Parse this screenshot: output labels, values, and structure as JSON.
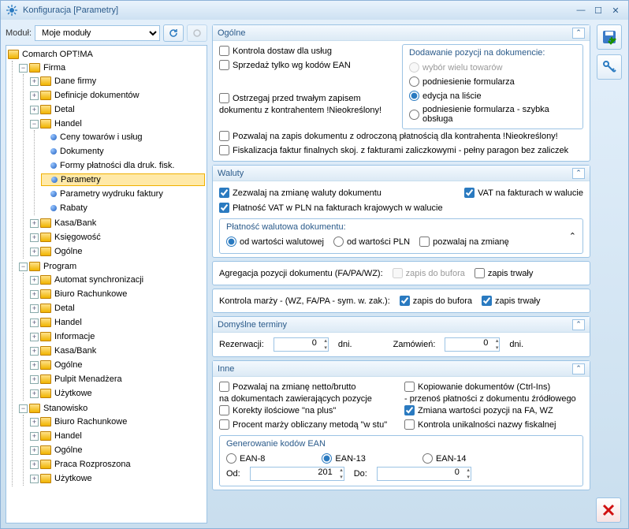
{
  "window": {
    "title": "Konfiguracja [Parametry]"
  },
  "module": {
    "label": "Moduł:",
    "value": "Moje moduły"
  },
  "tree": {
    "root": "Comarch OPT!MA",
    "firma": "Firma",
    "dane_firmy": "Dane firmy",
    "def_dok": "Definicje dokumentów",
    "detal": "Detal",
    "handel": "Handel",
    "ceny_tow": "Ceny towarów i usług",
    "dokumenty": "Dokumenty",
    "formy_plat": "Formy płatności dla druk. fisk.",
    "parametry": "Parametry",
    "param_wydr": "Parametry wydruku faktury",
    "rabaty": "Rabaty",
    "kasa_bank": "Kasa/Bank",
    "ksiegowosc": "Księgowość",
    "ogolne": "Ogólne",
    "program": "Program",
    "auto_sync": "Automat synchronizacji",
    "biuro_rach": "Biuro Rachunkowe",
    "informacje": "Informacje",
    "pulpit": "Pulpit Menadżera",
    "uzytkowe": "Użytkowe",
    "stanowisko": "Stanowisko",
    "praca_rozp": "Praca Rozproszona"
  },
  "ogolne": {
    "title": "Ogólne",
    "kontrola_dostaw": "Kontrola dostaw dla usług",
    "sprzedaz_ean": "Sprzedaż tylko wg kodów EAN",
    "ostrzegaj": "Ostrzegaj przed trwałym zapisem",
    "ostrzegaj2": "dokumentu z kontrahentem !Nieokreślony!",
    "pozwalaj_zapis": "Pozwalaj na zapis dokumentu z odroczoną płatnością dla kontrahenta !Nieokreślony!",
    "fiskalizacja": "Fiskalizacja faktur finalnych skoj. z fakturami zaliczkowymi - pełny paragon bez zaliczek",
    "dodawanie": {
      "title": "Dodawanie pozycji na dokumencie:",
      "r1": "wybór wielu towarów",
      "r2": "podniesienie formularza",
      "r3": "edycja na liście",
      "r4": "podniesienie formularza - szybka obsługa"
    }
  },
  "waluty": {
    "title": "Waluty",
    "zezwalaj": "Zezwalaj na zmianę waluty dokumentu",
    "vat_faktury": "VAT na fakturach w walucie",
    "platnosc_vat": "Płatność VAT w PLN na fakturach krajowych w walucie",
    "plat_walut": {
      "title": "Płatność walutowa dokumentu:",
      "r1": "od wartości walutowej",
      "r2": "od wartości PLN",
      "r3": "pozwalaj na zmianę"
    }
  },
  "agregacja": {
    "label": "Agregacja pozycji dokumentu (FA/PA/WZ):",
    "zapis_buf": "zapis do bufora",
    "zapis_trw": "zapis trwały"
  },
  "kontrola_marzy": {
    "label": "Kontrola marży - (WZ, FA/PA - sym. w. zak.):",
    "zapis_buf": "zapis do bufora",
    "zapis_trw": "zapis trwały"
  },
  "terminy": {
    "title": "Domyślne terminy",
    "rezerwacji": "Rezerwacji:",
    "rez_val": "0",
    "zamowien": "Zamówień:",
    "zam_val": "0",
    "dni": "dni."
  },
  "inne": {
    "title": "Inne",
    "pozwalaj_netto": "Pozwalaj na zmianę netto/brutto",
    "pozwalaj_netto2": "na dokumentach zawierających pozycje",
    "korekty": "Korekty ilościowe \"na plus\"",
    "procent_marzy": "Procent marży obliczany metodą \"w stu\"",
    "kopiowanie": "Kopiowanie dokumentów (Ctrl-Ins)",
    "kopiowanie2": "- przenoś płatności z dokumentu źródłowego",
    "zmiana_wart": "Zmiana wartości pozycji na FA, WZ",
    "kontrola_unik": "Kontrola unikalności nazwy fiskalnej",
    "gen_ean": {
      "title": "Generowanie kodów EAN",
      "r1": "EAN-8",
      "r2": "EAN-13",
      "r3": "EAN-14",
      "od": "Od:",
      "od_val": "201",
      "do": "Do:",
      "do_val": "0"
    }
  }
}
